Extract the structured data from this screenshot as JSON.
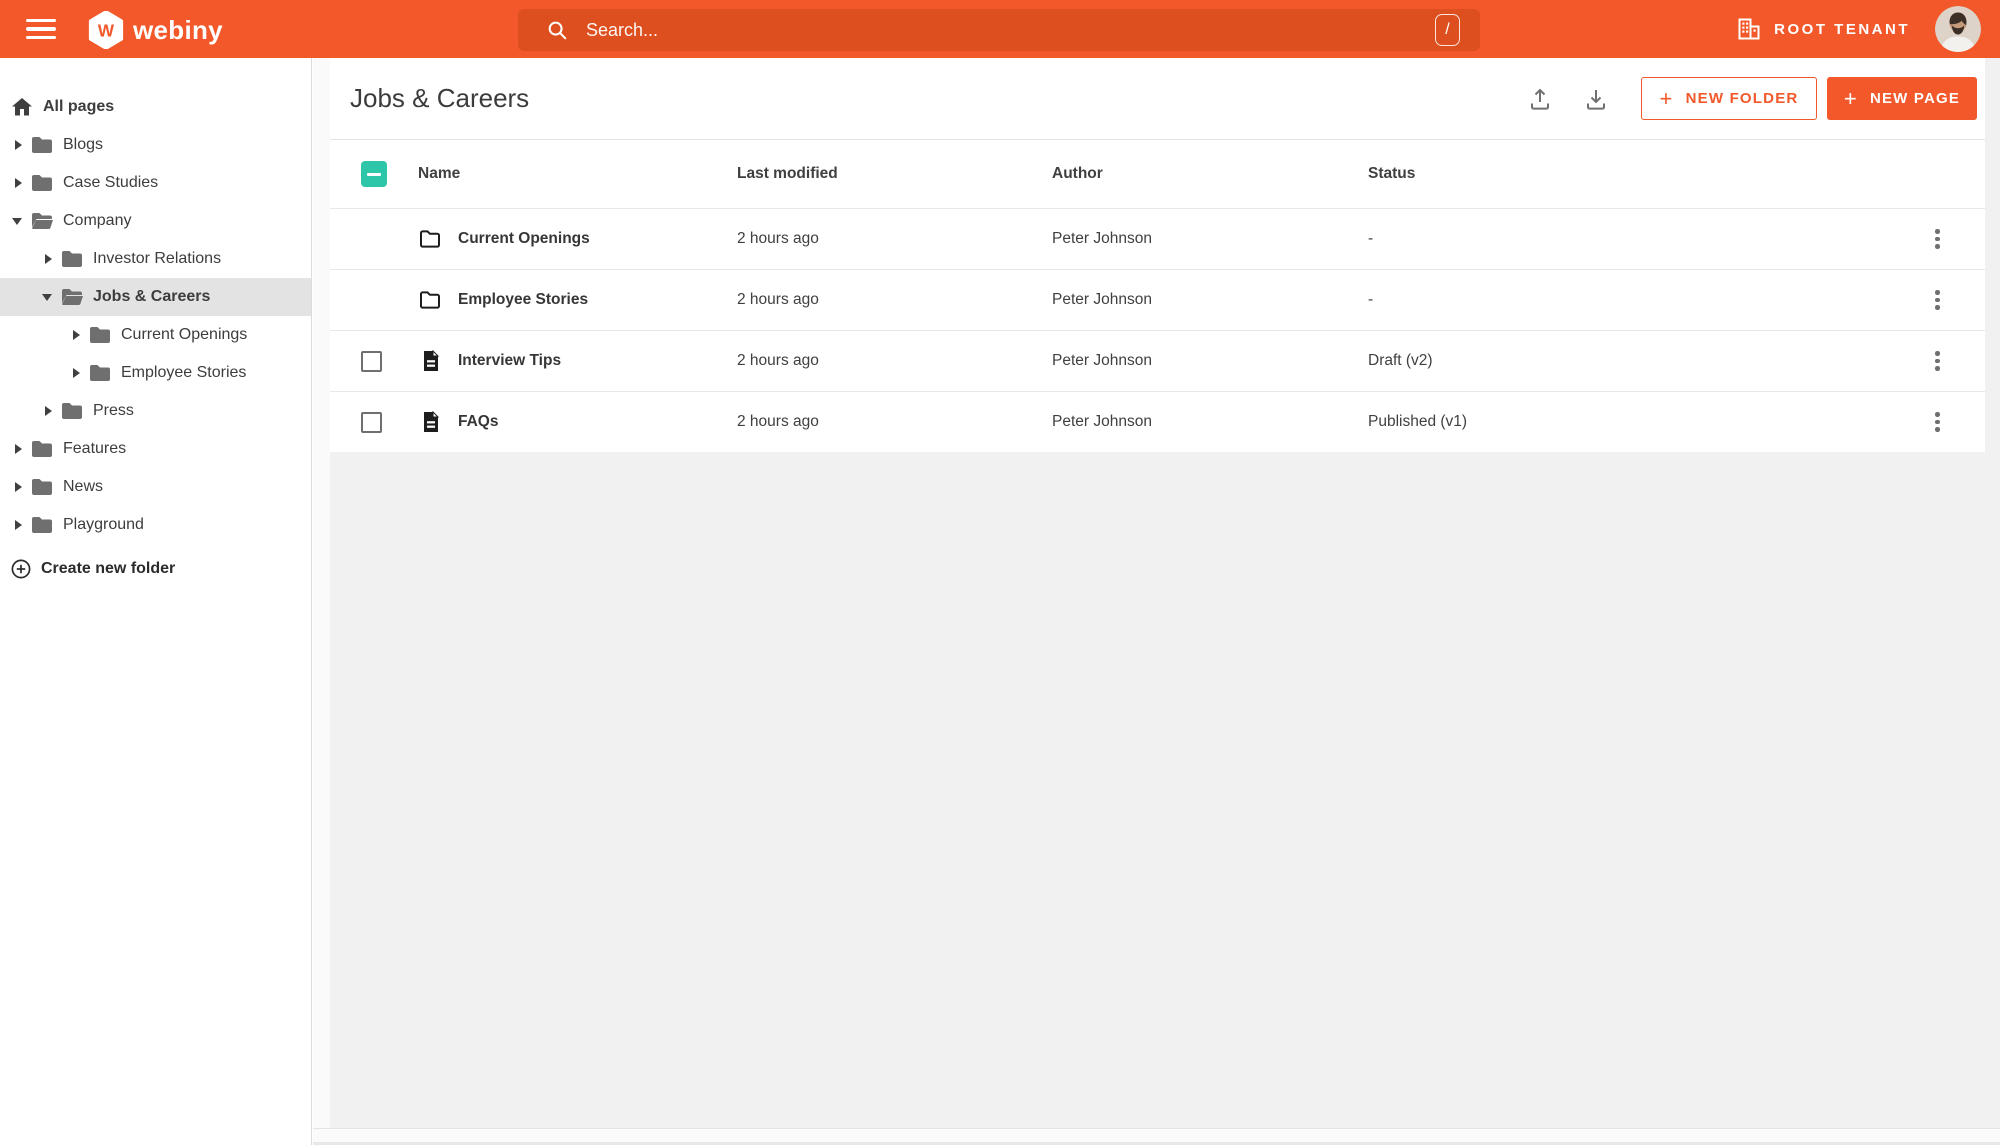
{
  "topbar": {
    "brand": "webiny",
    "brand_monogram": "W",
    "search": {
      "placeholder": "Search...",
      "shortcut": "/"
    },
    "tenant": "ROOT TENANT"
  },
  "sidebar": {
    "items": [
      {
        "label": "All pages"
      },
      {
        "label": "Blogs"
      },
      {
        "label": "Case Studies"
      },
      {
        "label": "Company"
      },
      {
        "label": "Investor Relations"
      },
      {
        "label": "Jobs & Careers"
      },
      {
        "label": "Current Openings"
      },
      {
        "label": "Employee Stories"
      },
      {
        "label": "Press"
      },
      {
        "label": "Features"
      },
      {
        "label": "News"
      },
      {
        "label": "Playground"
      }
    ],
    "create_folder_label": "Create new folder"
  },
  "main": {
    "title": "Jobs & Careers",
    "buttons": {
      "plus": "+",
      "new_folder": "NEW FOLDER",
      "new_page": "NEW PAGE"
    },
    "table": {
      "headers": [
        "Name",
        "Last modified",
        "Author",
        "Status"
      ],
      "rows": [
        {
          "type": "folder",
          "name": "Current Openings",
          "modified": "2 hours ago",
          "author": "Peter Johnson",
          "status": "-"
        },
        {
          "type": "folder",
          "name": "Employee Stories",
          "modified": "2 hours ago",
          "author": "Peter Johnson",
          "status": "-"
        },
        {
          "type": "page",
          "name": "Interview Tips",
          "modified": "2 hours ago",
          "author": "Peter Johnson",
          "status": "Draft (v2)"
        },
        {
          "type": "page",
          "name": "FAQs",
          "modified": "2 hours ago",
          "author": "Peter Johnson",
          "status": "Published (v1)"
        }
      ]
    }
  },
  "colors": {
    "brand_orange": "#f2582a",
    "search_orange": "#de4f1f",
    "checkbox_teal": "#2ec6a8"
  }
}
